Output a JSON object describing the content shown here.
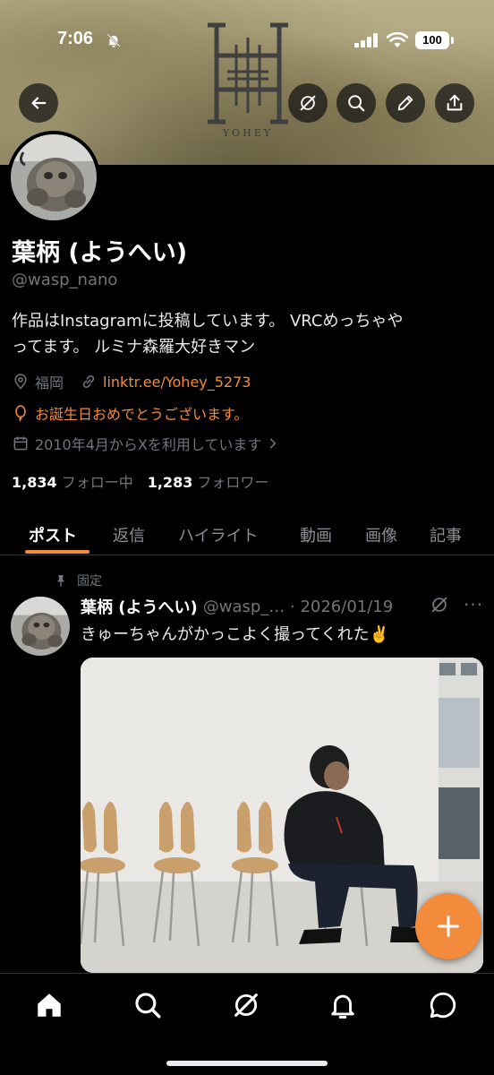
{
  "status_bar": {
    "time": "7:06",
    "battery": "100"
  },
  "banner": {
    "logo_text": "YOHEY"
  },
  "profile": {
    "display_name": "葉柄 (ようへい)",
    "handle": "@wasp_nano",
    "bio_line1": "作品はInstagramに投稿しています。 VRCめっちゃや",
    "bio_line2": "ってます。 ルミナ森羅大好きマン",
    "location": "福岡",
    "link": "linktr.ee/Yohey_5273",
    "birthday": "お誕生日おめでとうございます。",
    "joined": "2010年4月からXを利用しています",
    "following_count": "1,834",
    "following_label": "フォロー中",
    "followers_count": "1,283",
    "followers_label": "フォロワー"
  },
  "tabs": [
    {
      "label": "ポスト",
      "active": true
    },
    {
      "label": "返信"
    },
    {
      "label": "ハイライト"
    },
    {
      "label": "動画"
    },
    {
      "label": "画像"
    },
    {
      "label": "記事"
    }
  ],
  "post": {
    "pinned_label": "固定",
    "author_name": "葉柄 (ようへい)",
    "author_meta": "@wasp_… · 2026/01/19",
    "more": "···",
    "text": "きゅーちゃんがかっこよく撮ってくれた✌️"
  },
  "colors": {
    "accent": "#f28b3b",
    "background": "#000000",
    "muted": "#71767b"
  }
}
